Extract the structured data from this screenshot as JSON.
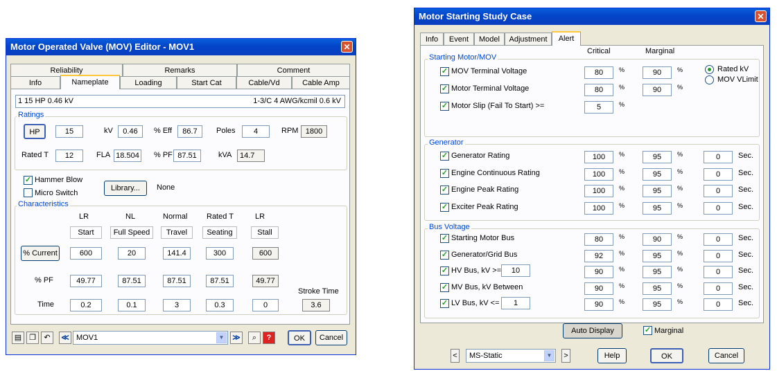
{
  "mov": {
    "title": "Motor Operated Valve (MOV) Editor - MOV1",
    "close": "✕",
    "tabs_row1": [
      "Reliability",
      "Remarks",
      "Comment"
    ],
    "tabs_row2": [
      "Info",
      "Nameplate",
      "Loading",
      "Start Cat",
      "Cable/Vd",
      "Cable Amp"
    ],
    "summary_left": "1  15 HP  0.46 kV",
    "summary_right": "1-3/C  4 AWG/kcmil  0.6 kV",
    "ratings": {
      "label": "Ratings",
      "hp_btn": "HP",
      "hp": "15",
      "kv_label": "kV",
      "kv": "0.46",
      "eff_label": "% Eff",
      "eff": "86.7",
      "poles_label": "Poles",
      "poles": "4",
      "rpm_label": "RPM",
      "rpm": "1800",
      "ratedt_label": "Rated T",
      "ratedt": "12",
      "fla_label": "FLA",
      "fla": "18.504",
      "pf_label": "% PF",
      "pf": "87.51",
      "kva_label": "kVA",
      "kva": "14.7"
    },
    "hammer_blow": "Hammer Blow",
    "micro_switch": "Micro Switch",
    "library_btn": "Library...",
    "library_value": "None",
    "characteristics": {
      "label": "Characteristics",
      "headers": [
        "LR",
        "NL",
        "Normal",
        "Rated T",
        "LR"
      ],
      "subheaders": [
        "Start",
        "Full Speed",
        "Travel",
        "Seating",
        "Stall"
      ],
      "current_btn": "% Current",
      "current": [
        "600",
        "20",
        "141.4",
        "300",
        "600"
      ],
      "pf_label": "% PF",
      "pf": [
        "49.77",
        "87.51",
        "87.51",
        "87.51",
        "49.77"
      ],
      "time_label": "Time",
      "time": [
        "0.2",
        "0.1",
        "3",
        "0.3",
        "0"
      ],
      "stroke_label": "Stroke Time",
      "stroke": "3.6"
    },
    "bottom": {
      "combo": "MOV1",
      "ok": "OK",
      "cancel": "Cancel",
      "prev": "≪",
      "next": "≫",
      "help": "?",
      "find": "🔍"
    }
  },
  "msc": {
    "title": "Motor Starting Study Case",
    "close": "✕",
    "tabs": [
      "Info",
      "Event",
      "Model",
      "Adjustment",
      "Alert"
    ],
    "col_critical": "Critical",
    "col_marginal": "Marginal",
    "pct": "%",
    "sec": "Sec.",
    "starting": {
      "label": "Starting Motor/MOV",
      "rows": [
        {
          "label": "MOV Terminal Voltage",
          "critical": "80",
          "marginal": "90"
        },
        {
          "label": "Motor Terminal Voltage",
          "critical": "80",
          "marginal": "90"
        },
        {
          "label": "Motor Slip (Fail To Start) >=",
          "critical": "5",
          "marginal": ""
        }
      ],
      "radio_rated": "Rated kV",
      "radio_vlimit": "MOV VLimit"
    },
    "generator": {
      "label": "Generator",
      "rows": [
        {
          "label": "Generator Rating",
          "critical": "100",
          "marginal": "95",
          "sec": "0"
        },
        {
          "label": "Engine Continuous Rating",
          "critical": "100",
          "marginal": "95",
          "sec": "0"
        },
        {
          "label": "Engine Peak Rating",
          "critical": "100",
          "marginal": "95",
          "sec": "0"
        },
        {
          "label": "Exciter Peak Rating",
          "critical": "100",
          "marginal": "95",
          "sec": "0"
        }
      ]
    },
    "bus": {
      "label": "Bus Voltage",
      "rows": [
        {
          "label": "Starting Motor Bus",
          "critical": "80",
          "marginal": "90",
          "sec": "0"
        },
        {
          "label": "Generator/Grid Bus",
          "critical": "92",
          "marginal": "95",
          "sec": "0"
        },
        {
          "label": "HV Bus, kV >=",
          "critical": "90",
          "marginal": "95",
          "sec": "0",
          "kv": "10"
        },
        {
          "label": "MV Bus, kV Between",
          "critical": "90",
          "marginal": "95",
          "sec": "0"
        },
        {
          "label": "LV Bus, kV <=",
          "critical": "90",
          "marginal": "95",
          "sec": "0",
          "kv": "1"
        }
      ]
    },
    "auto_display": "Auto Display",
    "marginal_chk": "Marginal",
    "study_combo": "MS-Static",
    "help": "Help",
    "ok": "OK",
    "cancel": "Cancel",
    "prev": "<",
    "next": ">"
  }
}
